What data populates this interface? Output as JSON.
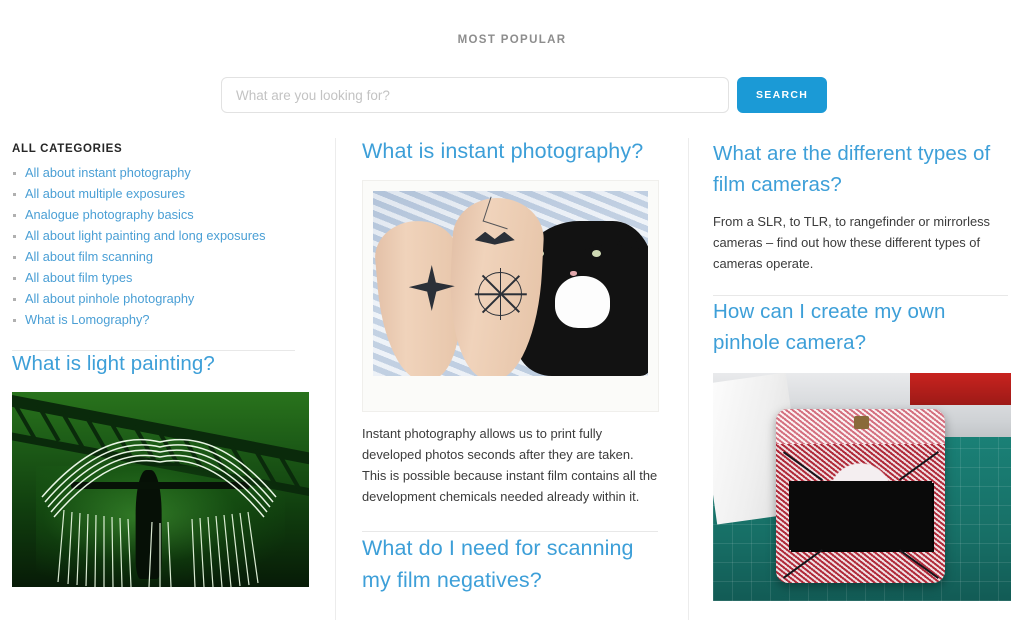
{
  "header": {
    "section_label": "MOST POPULAR"
  },
  "search": {
    "placeholder": "What are you looking for?",
    "value": "",
    "button_label": "SEARCH",
    "button_color": "#1b9ad6"
  },
  "sidebar": {
    "title": "ALL CATEGORIES",
    "items": [
      {
        "label": "All about instant photography"
      },
      {
        "label": "All about multiple exposures"
      },
      {
        "label": "Analogue photography basics"
      },
      {
        "label": "All about light painting and long exposures"
      },
      {
        "label": "All about film scanning"
      },
      {
        "label": "All about film types"
      },
      {
        "label": "All about pinhole photography"
      },
      {
        "label": "What is Lomography?"
      }
    ],
    "featured": {
      "title": "What is light painting?",
      "image_alt": "Light painting photograph of a silhouetted figure with glowing white wings under a green-lit steel truss bridge"
    }
  },
  "center_column": {
    "articles": [
      {
        "title": "What is instant photography?",
        "image_alt": "Instant film print of tattooed legs on a light blue knit blanket beside a black and white tuxedo cat",
        "body": "Instant photography allows us to print fully developed photos seconds after they are taken. This is possible because instant film contains all the development chemicals needed already within it."
      },
      {
        "title": "What do I need for scanning my film negatives?"
      }
    ]
  },
  "right_column": {
    "articles": [
      {
        "title": "What are the different types of film cameras?",
        "body": "From a SLR, to TLR, to rangefinder or mirrorless cameras – find out how these different types of cameras operate."
      },
      {
        "title": "How can I create my own pinhole camera?",
        "image_alt": "Handmade pinhole camera built from a red and white patterned biscuit tin resting on a teal cutting mat"
      }
    ]
  },
  "theme": {
    "link_blue": "#4a9fd5",
    "heading_blue": "#3d9fd8",
    "label_grey": "#8d8d8d",
    "body_text": "#3b3b3b",
    "divider": "#ececec"
  }
}
